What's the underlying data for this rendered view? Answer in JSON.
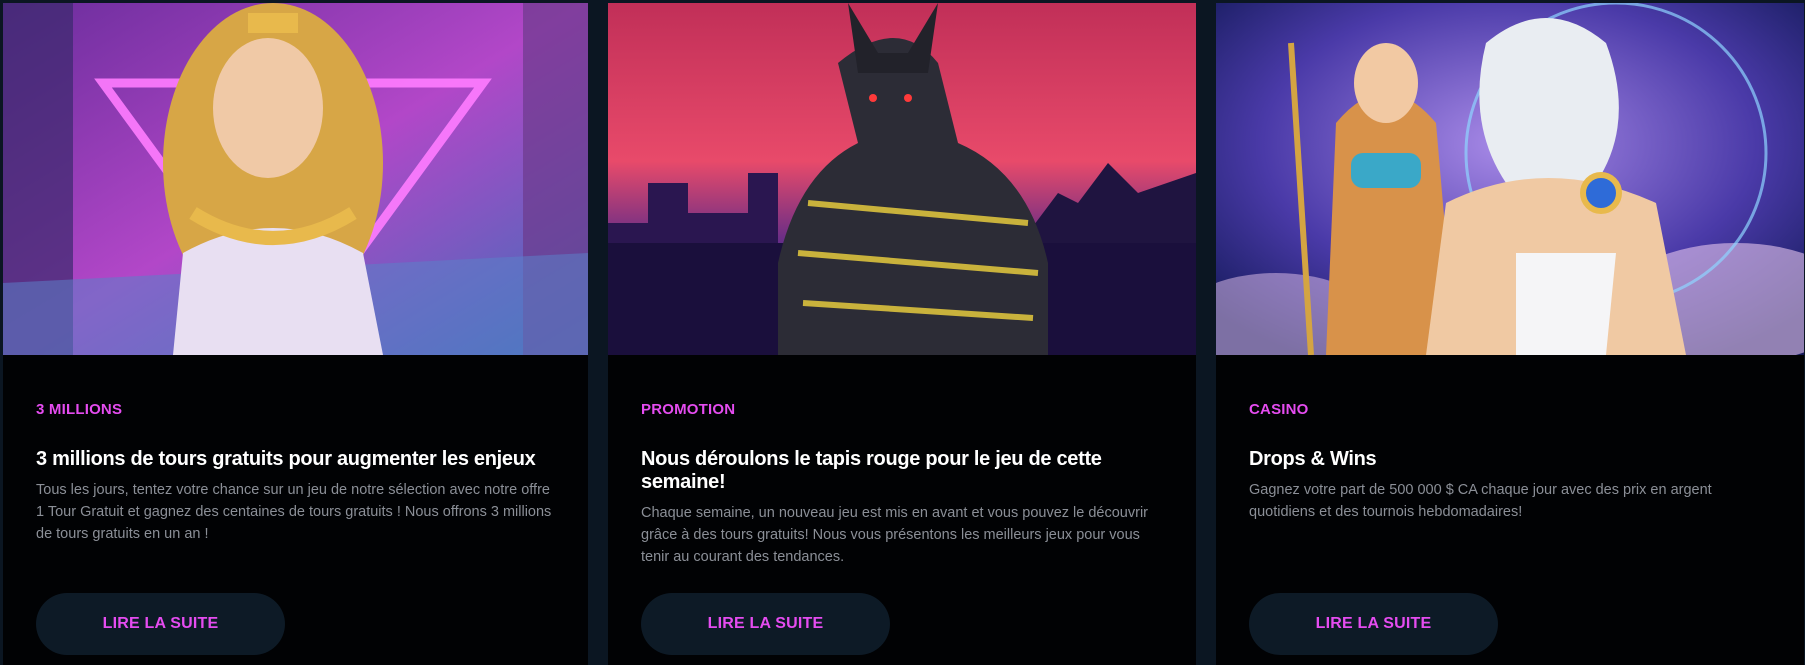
{
  "cards": [
    {
      "image_alt": "Cleopatra slot artwork",
      "tag": "3 MILLIONS",
      "title": "3 millions de tours gratuits pour augmenter les enjeux",
      "description": "Tous les jours, tentez votre chance sur un jeu de notre sélection avec notre offre 1 Tour Gratuit et gagnez des centaines de tours gratuits ! Nous offrons 3 millions de tours gratuits en un an !",
      "button": "LIRE LA SUITE"
    },
    {
      "image_alt": "Anubis slot artwork",
      "tag": "PROMOTION",
      "title": "Nous déroulons le tapis rouge pour le jeu de cette semaine!",
      "description": "Chaque semaine, un nouveau jeu est mis en avant et vous pouvez le découvrir grâce à des tours gratuits! Nous vous présentons les meilleurs jeux pour vous tenir au courant des tendances.",
      "button": "LIRE LA SUITE"
    },
    {
      "image_alt": "Zeus and Cleopatra slot artwork",
      "tag": "CASINO",
      "title": "Drops & Wins",
      "description": "Gagnez votre part de 500 000 $ CA chaque jour avec des prix en argent quotidiens et des tournois hebdomadaires!",
      "button": "LIRE LA SUITE"
    }
  ],
  "colors": {
    "page_bg": "#0b1622",
    "card_bg": "#010204",
    "accent": "#e54cf0",
    "title": "#ffffff",
    "text": "#8b8f97",
    "button_bg": "#0d1a26"
  }
}
